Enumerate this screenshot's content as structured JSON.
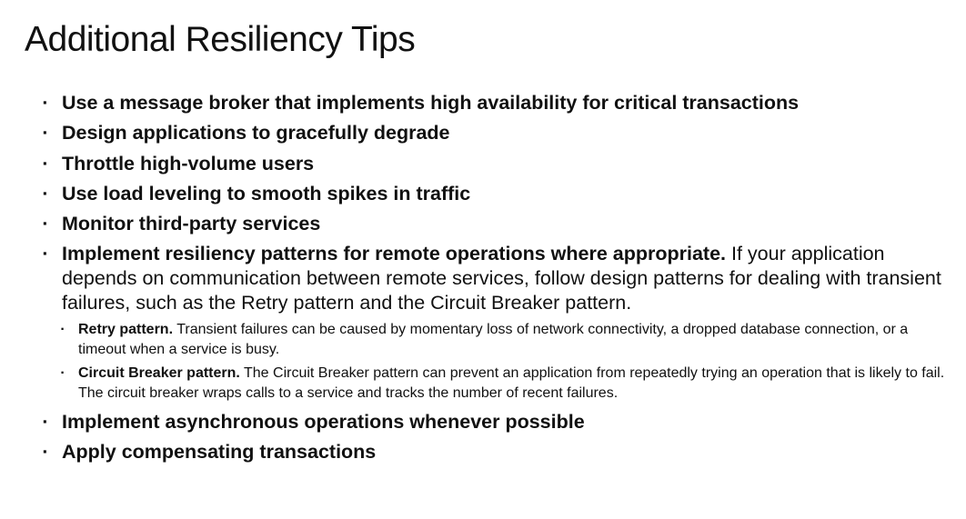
{
  "title": "Additional Resiliency Tips",
  "bullet_marker": "·",
  "bullets": [
    {
      "lead": "Use a message broker that implements high availability for critical transactions",
      "body": ""
    },
    {
      "lead": "Design applications to gracefully degrade",
      "body": ""
    },
    {
      "lead": "Throttle high-volume users",
      "body": ""
    },
    {
      "lead": "Use load leveling to smooth spikes in traffic",
      "body": ""
    },
    {
      "lead": "Monitor third-party services",
      "body": ""
    },
    {
      "lead": "Implement resiliency patterns for remote operations where appropriate.",
      "body": " If your application depends on communication between remote services, follow design patterns for dealing with transient failures, such as the Retry pattern and the Circuit Breaker pattern.",
      "subbullets": [
        {
          "lead": "Retry pattern.",
          "body": " Transient failures can be caused by momentary loss of network connectivity, a dropped database connection, or a timeout when a service is busy."
        },
        {
          "lead": "Circuit Breaker pattern.",
          "body": " The Circuit Breaker pattern can prevent an application from repeatedly trying an operation that is likely to fail. The circuit breaker wraps calls to a service and tracks the number of recent failures."
        }
      ]
    },
    {
      "lead": "Implement asynchronous operations whenever possible",
      "body": ""
    },
    {
      "lead": "Apply compensating transactions",
      "body": ""
    }
  ]
}
